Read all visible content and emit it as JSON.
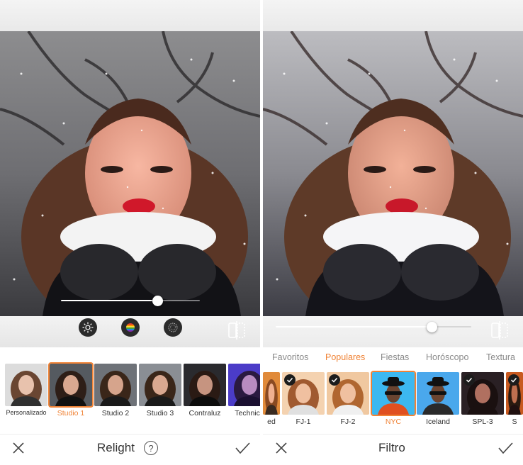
{
  "left_panel": {
    "tools": [
      {
        "icon": "brightness-icon"
      },
      {
        "icon": "rainbow-color-icon"
      },
      {
        "icon": "texture-icon"
      }
    ],
    "slider": {
      "value": 0.67
    },
    "presets": [
      {
        "label": "Personalizado",
        "selected": false
      },
      {
        "label": "Studio 1",
        "selected": true
      },
      {
        "label": "Studio 2",
        "selected": false
      },
      {
        "label": "Studio 3",
        "selected": false
      },
      {
        "label": "Contraluz",
        "selected": false
      },
      {
        "label": "Technico",
        "selected": false
      }
    ],
    "title": "Relight",
    "help_label": "?"
  },
  "right_panel": {
    "slider": {
      "value": 0.78
    },
    "categories": [
      {
        "label": "Favoritos",
        "active": false
      },
      {
        "label": "Populares",
        "active": true
      },
      {
        "label": "Fiestas",
        "active": false
      },
      {
        "label": "Horóscopo",
        "active": false
      },
      {
        "label": "Textura",
        "active": false
      }
    ],
    "filters": [
      {
        "label": "ed",
        "selected": false,
        "checked": false
      },
      {
        "label": "FJ-1",
        "selected": false,
        "checked": true
      },
      {
        "label": "FJ-2",
        "selected": false,
        "checked": true
      },
      {
        "label": "NYC",
        "selected": true,
        "checked": false
      },
      {
        "label": "Iceland",
        "selected": false,
        "checked": false
      },
      {
        "label": "SPL-3",
        "selected": false,
        "checked": true
      },
      {
        "label": "S",
        "selected": false,
        "checked": true
      }
    ],
    "title": "Filtro"
  },
  "colors": {
    "accent": "#f08336",
    "text": "#333333",
    "muted": "#8a8a8a"
  }
}
